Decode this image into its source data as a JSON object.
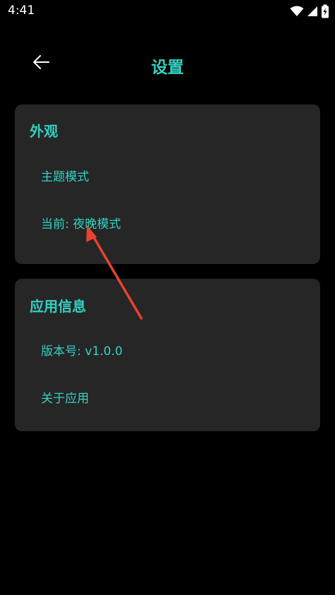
{
  "status_bar": {
    "time": "4:41",
    "icons": [
      "wifi-icon",
      "signal-icon",
      "battery-charging-icon"
    ]
  },
  "header": {
    "back_icon": "arrow-left-icon",
    "title": "设置"
  },
  "sections": {
    "appearance": {
      "title": "外观",
      "items": [
        "主题模式",
        "当前: 夜晚模式"
      ]
    },
    "app_info": {
      "title": "应用信息",
      "items": [
        "版本号: v1.0.0",
        "关于应用"
      ]
    }
  },
  "colors": {
    "background": "#000000",
    "card": "#262626",
    "accent": "#35d0c2",
    "annotation": "#e8432f"
  }
}
